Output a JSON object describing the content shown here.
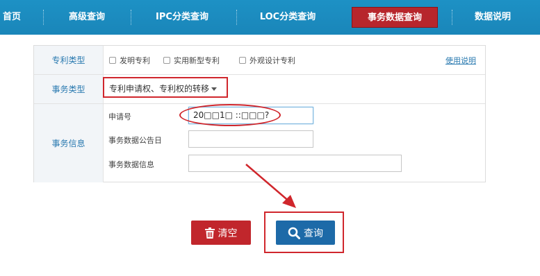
{
  "nav": {
    "items": [
      {
        "label": "首页"
      },
      {
        "label": "高级查询"
      },
      {
        "label": "IPC分类查询"
      },
      {
        "label": "LOC分类查询"
      },
      {
        "label": "事务数据查询",
        "active": true
      },
      {
        "label": "数据说明"
      }
    ]
  },
  "form": {
    "patent_type": {
      "label": "专利类型",
      "options": [
        "发明专利",
        "实用新型专利",
        "外观设计专利"
      ],
      "help_link": "使用说明"
    },
    "affair_type": {
      "label": "事务类型",
      "selected": "专利申请权、专利权的转移"
    },
    "affair_info": {
      "label": "事务信息",
      "application_no": {
        "label": "申请号",
        "value": "20□□1□ ::□□□?"
      },
      "announce_date": {
        "label": "事务数据公告日",
        "value": ""
      },
      "data_info": {
        "label": "事务数据信息",
        "value": ""
      }
    }
  },
  "buttons": {
    "clear": "清空",
    "search": "查询"
  },
  "colors": {
    "nav_bg": "#1a88bb",
    "nav_active": "#b7262c",
    "annotation_red": "#d0262c",
    "search_button": "#1d6aa8",
    "clear_button": "#c1262c"
  },
  "icons": {
    "clear": "trash-icon",
    "search": "magnifier-icon",
    "dropdown": "caret-down-icon"
  }
}
